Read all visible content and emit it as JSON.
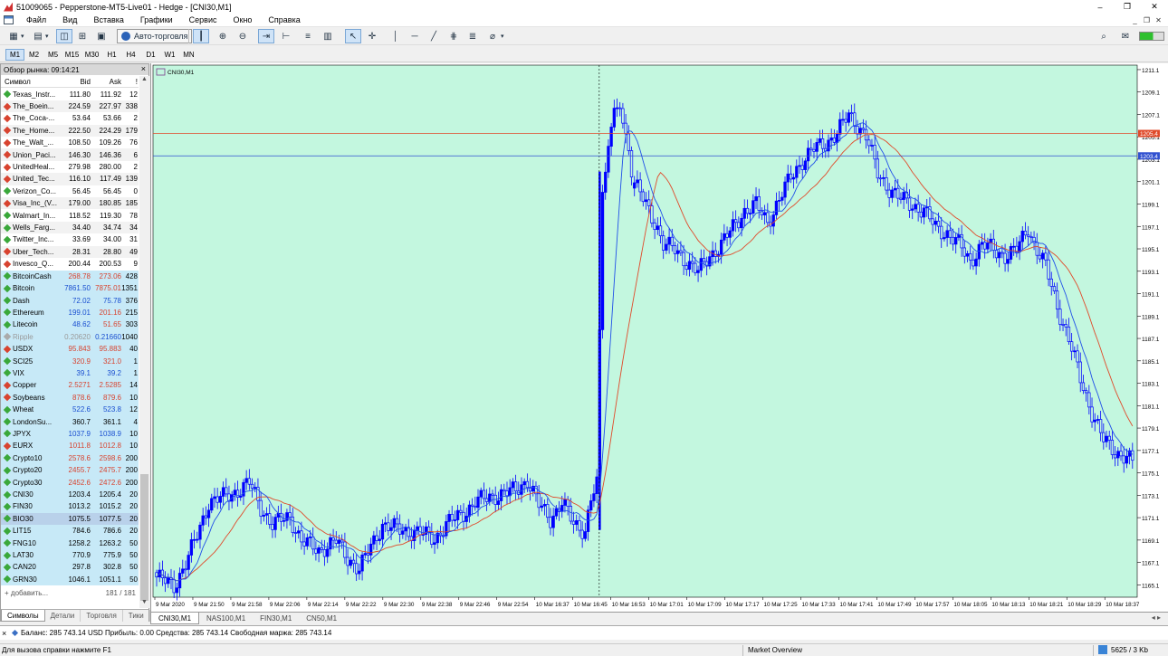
{
  "window": {
    "title": "51009065 - Pepperstone-MT5-Live01 - Hedge - [CNI30,M1]",
    "controls": [
      "–",
      "❐",
      "✕"
    ]
  },
  "menu": [
    "Файл",
    "Вид",
    "Вставка",
    "Графики",
    "Сервис",
    "Окно",
    "Справка"
  ],
  "toolbar": {
    "autotrade_label": "Авто-торговля"
  },
  "timeframes": [
    "M1",
    "M2",
    "M5",
    "M15",
    "M30",
    "H1",
    "H4",
    "D1",
    "W1",
    "MN"
  ],
  "active_timeframe": "M1",
  "market_watch": {
    "title": "Обзор рынка: 09:14:21",
    "close": "×",
    "columns": [
      "Символ",
      "Bid",
      "Ask",
      "!"
    ],
    "rows": [
      {
        "symbol": "Texas_Instr...",
        "bid": "111.80",
        "ask": "111.92",
        "spread": "12",
        "dir": "up",
        "style": "plain",
        "bg": "w"
      },
      {
        "symbol": "The_Boein...",
        "bid": "224.59",
        "ask": "227.97",
        "spread": "338",
        "dir": "dn",
        "style": "plain",
        "bg": "a"
      },
      {
        "symbol": "The_Coca-...",
        "bid": "53.64",
        "ask": "53.66",
        "spread": "2",
        "dir": "dn",
        "style": "plain",
        "bg": "w"
      },
      {
        "symbol": "The_Home...",
        "bid": "222.50",
        "ask": "224.29",
        "spread": "179",
        "dir": "dn",
        "style": "plain",
        "bg": "a"
      },
      {
        "symbol": "The_Walt_...",
        "bid": "108.50",
        "ask": "109.26",
        "spread": "76",
        "dir": "dn",
        "style": "plain",
        "bg": "w"
      },
      {
        "symbol": "Union_Paci...",
        "bid": "146.30",
        "ask": "146.36",
        "spread": "6",
        "dir": "dn",
        "style": "plain",
        "bg": "a"
      },
      {
        "symbol": "UnitedHeal...",
        "bid": "279.98",
        "ask": "280.00",
        "spread": "2",
        "dir": "dn",
        "style": "plain",
        "bg": "w"
      },
      {
        "symbol": "United_Tec...",
        "bid": "116.10",
        "ask": "117.49",
        "spread": "139",
        "dir": "dn",
        "style": "plain",
        "bg": "a"
      },
      {
        "symbol": "Verizon_Co...",
        "bid": "56.45",
        "ask": "56.45",
        "spread": "0",
        "dir": "up",
        "style": "plain",
        "bg": "w"
      },
      {
        "symbol": "Visa_Inc_(V...",
        "bid": "179.00",
        "ask": "180.85",
        "spread": "185",
        "dir": "dn",
        "style": "plain",
        "bg": "a"
      },
      {
        "symbol": "Walmart_In...",
        "bid": "118.52",
        "ask": "119.30",
        "spread": "78",
        "dir": "up",
        "style": "plain",
        "bg": "w"
      },
      {
        "symbol": "Wells_Farg...",
        "bid": "34.40",
        "ask": "34.74",
        "spread": "34",
        "dir": "up",
        "style": "plain",
        "bg": "a"
      },
      {
        "symbol": "Twitter_Inc...",
        "bid": "33.69",
        "ask": "34.00",
        "spread": "31",
        "dir": "up",
        "style": "plain",
        "bg": "w"
      },
      {
        "symbol": "Uber_Tech...",
        "bid": "28.31",
        "ask": "28.80",
        "spread": "49",
        "dir": "dn",
        "style": "plain",
        "bg": "a"
      },
      {
        "symbol": "Invesco_Q...",
        "bid": "200.44",
        "ask": "200.53",
        "spread": "9",
        "dir": "dn",
        "style": "plain",
        "bg": "w"
      },
      {
        "symbol": "BitcoinCash",
        "bid": "268.78",
        "ask": "273.06",
        "spread": "428",
        "dir": "up",
        "style": "red",
        "bg": "b"
      },
      {
        "symbol": "Bitcoin",
        "bid": "7861.50",
        "ask": "7875.01",
        "spread": "1351",
        "dir": "up",
        "style": "mix",
        "bg": "b"
      },
      {
        "symbol": "Dash",
        "bid": "72.02",
        "ask": "75.78",
        "spread": "376",
        "dir": "up",
        "style": "blue",
        "bg": "b"
      },
      {
        "symbol": "Ethereum",
        "bid": "199.01",
        "ask": "201.16",
        "spread": "215",
        "dir": "up",
        "style": "mix",
        "bg": "b"
      },
      {
        "symbol": "Litecoin",
        "bid": "48.62",
        "ask": "51.65",
        "spread": "303",
        "dir": "up",
        "style": "mix",
        "bg": "b"
      },
      {
        "symbol": "Ripple",
        "bid": "0.20620",
        "ask": "0.21660",
        "spread": "1040",
        "dir": "gr",
        "style": "gray",
        "bg": "b"
      },
      {
        "symbol": "USDX",
        "bid": "95.843",
        "ask": "95.883",
        "spread": "40",
        "dir": "dn",
        "style": "red",
        "bg": "b"
      },
      {
        "symbol": "SCI25",
        "bid": "320.9",
        "ask": "321.0",
        "spread": "1",
        "dir": "up",
        "style": "red",
        "bg": "b"
      },
      {
        "symbol": "VIX",
        "bid": "39.1",
        "ask": "39.2",
        "spread": "1",
        "dir": "up",
        "style": "blue",
        "bg": "b"
      },
      {
        "symbol": "Copper",
        "bid": "2.5271",
        "ask": "2.5285",
        "spread": "14",
        "dir": "dn",
        "style": "red",
        "bg": "b"
      },
      {
        "symbol": "Soybeans",
        "bid": "878.6",
        "ask": "879.6",
        "spread": "10",
        "dir": "dn",
        "style": "red",
        "bg": "b"
      },
      {
        "symbol": "Wheat",
        "bid": "522.6",
        "ask": "523.8",
        "spread": "12",
        "dir": "up",
        "style": "blue",
        "bg": "b"
      },
      {
        "symbol": "LondonSu...",
        "bid": "360.7",
        "ask": "361.1",
        "spread": "4",
        "dir": "up",
        "style": "plain",
        "bg": "b"
      },
      {
        "symbol": "JPYX",
        "bid": "1037.9",
        "ask": "1038.9",
        "spread": "10",
        "dir": "up",
        "style": "blue",
        "bg": "b"
      },
      {
        "symbol": "EURX",
        "bid": "1011.8",
        "ask": "1012.8",
        "spread": "10",
        "dir": "dn",
        "style": "red",
        "bg": "b"
      },
      {
        "symbol": "Crypto10",
        "bid": "2578.6",
        "ask": "2598.6",
        "spread": "200",
        "dir": "up",
        "style": "red",
        "bg": "b"
      },
      {
        "symbol": "Crypto20",
        "bid": "2455.7",
        "ask": "2475.7",
        "spread": "200",
        "dir": "up",
        "style": "red",
        "bg": "b"
      },
      {
        "symbol": "Crypto30",
        "bid": "2452.6",
        "ask": "2472.6",
        "spread": "200",
        "dir": "up",
        "style": "red",
        "bg": "b"
      },
      {
        "symbol": "CNI30",
        "bid": "1203.4",
        "ask": "1205.4",
        "spread": "20",
        "dir": "up",
        "style": "plain",
        "bg": "b"
      },
      {
        "symbol": "FIN30",
        "bid": "1013.2",
        "ask": "1015.2",
        "spread": "20",
        "dir": "up",
        "style": "plain",
        "bg": "b"
      },
      {
        "symbol": "BIO30",
        "bid": "1075.5",
        "ask": "1077.5",
        "spread": "20",
        "dir": "up",
        "style": "plain",
        "bg": "s"
      },
      {
        "symbol": "LIT15",
        "bid": "784.6",
        "ask": "786.6",
        "spread": "20",
        "dir": "up",
        "style": "plain",
        "bg": "b"
      },
      {
        "symbol": "FNG10",
        "bid": "1258.2",
        "ask": "1263.2",
        "spread": "50",
        "dir": "up",
        "style": "plain",
        "bg": "b"
      },
      {
        "symbol": "LAT30",
        "bid": "770.9",
        "ask": "775.9",
        "spread": "50",
        "dir": "up",
        "style": "plain",
        "bg": "b"
      },
      {
        "symbol": "CAN20",
        "bid": "297.8",
        "ask": "302.8",
        "spread": "50",
        "dir": "up",
        "style": "plain",
        "bg": "b"
      },
      {
        "symbol": "GRN30",
        "bid": "1046.1",
        "ask": "1051.1",
        "spread": "50",
        "dir": "up",
        "style": "plain",
        "bg": "b"
      }
    ],
    "add_label": "+ добавить...",
    "count": "181 / 181",
    "tabs": [
      "Символы",
      "Детали",
      "Торговля",
      "Тики"
    ]
  },
  "chart": {
    "symbol_label": "CNI30,M1",
    "background": "#c3f7df",
    "bull_color": "#0000ff",
    "bear_color": "#0000ff",
    "ma_fast_color": "#2050e8",
    "ma_slow_color": "#e04a2a",
    "price_levels": [
      "1211.1",
      "1209.1",
      "1207.1",
      "1205.1",
      "1203.1",
      "1201.1",
      "1199.1",
      "1197.1",
      "1195.1",
      "1193.1",
      "1191.1",
      "1189.1",
      "1187.1",
      "1185.1",
      "1183.1",
      "1181.1",
      "1179.1",
      "1177.1",
      "1175.1",
      "1173.1",
      "1171.1",
      "1169.1",
      "1167.1",
      "1165.1"
    ],
    "ask_label": "1205.4",
    "bid_label": "1203.4",
    "ask_value": 1205.4,
    "bid_value": 1203.4,
    "time_labels": [
      "9 Mar 2020",
      "9 Mar 21:50",
      "9 Mar 21:58",
      "9 Mar 22:06",
      "9 Mar 22:14",
      "9 Mar 22:22",
      "9 Mar 22:30",
      "9 Mar 22:38",
      "9 Mar 22:46",
      "9 Mar 22:54",
      "10 Mar 16:37",
      "10 Mar 16:45",
      "10 Mar 16:53",
      "10 Mar 17:01",
      "10 Mar 17:09",
      "10 Mar 17:17",
      "10 Mar 17:25",
      "10 Mar 17:33",
      "10 Mar 17:41",
      "10 Mar 17:49",
      "10 Mar 17:57",
      "10 Mar 18:05",
      "10 Mar 18:13",
      "10 Mar 18:21",
      "10 Mar 18:29",
      "10 Mar 18:37"
    ]
  },
  "chart_data": {
    "type": "candlestick",
    "symbol": "CNI30",
    "timeframe": "M1",
    "ylim": [
      1164.0,
      1211.5
    ],
    "bars_count": 165,
    "close_path": [
      [
        0,
        1165.8
      ],
      [
        6,
        1165.0
      ],
      [
        10,
        1167.0
      ],
      [
        14,
        1169.5
      ],
      [
        18,
        1172.5
      ],
      [
        24,
        1173.0
      ],
      [
        28,
        1173.5
      ],
      [
        32,
        1174.2
      ],
      [
        36,
        1172.0
      ],
      [
        40,
        1170.5
      ],
      [
        46,
        1171.2
      ],
      [
        50,
        1169.0
      ],
      [
        56,
        1168.2
      ],
      [
        62,
        1169.0
      ],
      [
        66,
        1167.5
      ],
      [
        70,
        1166.5
      ],
      [
        74,
        1168.5
      ],
      [
        78,
        1170.5
      ],
      [
        84,
        1170.0
      ],
      [
        90,
        1169.8
      ],
      [
        96,
        1169.2
      ],
      [
        100,
        1170.5
      ],
      [
        106,
        1171.5
      ],
      [
        110,
        1172.5
      ],
      [
        116,
        1173.0
      ],
      [
        120,
        1173.3
      ],
      [
        124,
        1173.5
      ],
      [
        128,
        1174.5
      ],
      [
        132,
        1172.2
      ],
      [
        136,
        1171.0
      ],
      [
        140,
        1172.5
      ],
      [
        144,
        1170.5
      ],
      [
        148,
        1170.0
      ],
      [
        150,
        1172.8
      ],
      [
        152,
        1174.0
      ],
      [
        154,
        1200.5
      ],
      [
        156,
        1204.0
      ],
      [
        158,
        1208.5
      ],
      [
        160,
        1207.0
      ],
      [
        162,
        1205.5
      ],
      [
        164,
        1201.0
      ]
    ],
    "close_path_after_gap": [
      [
        0,
        1201.0
      ],
      [
        4,
        1199.0
      ],
      [
        8,
        1197.0
      ],
      [
        10,
        1195.5
      ],
      [
        14,
        1195.0
      ],
      [
        18,
        1194.0
      ],
      [
        22,
        1193.0
      ],
      [
        26,
        1194.5
      ],
      [
        30,
        1195.5
      ],
      [
        34,
        1197.0
      ],
      [
        38,
        1198.5
      ],
      [
        42,
        1199.0
      ],
      [
        46,
        1197.5
      ],
      [
        50,
        1199.5
      ],
      [
        54,
        1201.5
      ],
      [
        58,
        1203.0
      ],
      [
        62,
        1204.0
      ],
      [
        66,
        1204.5
      ],
      [
        70,
        1205.5
      ],
      [
        74,
        1207.0
      ],
      [
        76,
        1206.5
      ],
      [
        80,
        1205.2
      ],
      [
        82,
        1203.5
      ],
      [
        84,
        1201.8
      ],
      [
        88,
        1200.5
      ],
      [
        92,
        1199.5
      ],
      [
        96,
        1199.0
      ],
      [
        100,
        1198.5
      ],
      [
        104,
        1197.0
      ],
      [
        108,
        1196.5
      ],
      [
        112,
        1195.5
      ],
      [
        116,
        1194.0
      ],
      [
        120,
        1195.5
      ],
      [
        124,
        1195.0
      ],
      [
        128,
        1194.5
      ],
      [
        132,
        1195.0
      ],
      [
        136,
        1197.0
      ],
      [
        138,
        1195.5
      ],
      [
        142,
        1193.5
      ],
      [
        146,
        1190.0
      ],
      [
        150,
        1187.0
      ],
      [
        154,
        1183.5
      ],
      [
        158,
        1180.5
      ],
      [
        162,
        1178.0
      ],
      [
        166,
        1177.0
      ],
      [
        170,
        1176.5
      ],
      [
        172,
        1176.0
      ]
    ],
    "ask_line": 1205.4,
    "bid_line": 1203.4
  },
  "chart_tabs": [
    "CNI30,M1",
    "NAS100,M1",
    "FIN30,M1",
    "CN50,M1"
  ],
  "terminal_bar": {
    "close": "×",
    "balance_text": "Баланс: 285 743.14 USD  Прибыль: 0.00  Средства: 285 743.14  Свободная маржа: 285 743.14"
  },
  "status": {
    "help": "Для вызова справки нажмите F1",
    "profile": "Market Overview",
    "traffic": "5625 / 3 Kb"
  }
}
